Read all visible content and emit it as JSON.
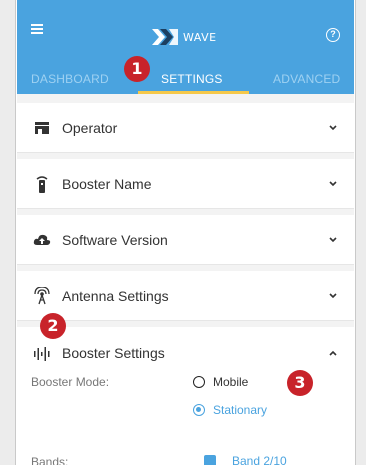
{
  "app": {
    "brand": "WAVE"
  },
  "tabs": [
    {
      "label": "DASHBOARD"
    },
    {
      "label": "SETTINGS",
      "active": true
    },
    {
      "label": "ADVANCED"
    }
  ],
  "callouts": [
    "1",
    "2",
    "3"
  ],
  "sections": [
    {
      "label": "Operator",
      "icon": "operator-icon"
    },
    {
      "label": "Booster Name",
      "icon": "booster-device-icon"
    },
    {
      "label": "Software Version",
      "icon": "cloud-upload-icon"
    },
    {
      "label": "Antenna Settings",
      "icon": "antenna-icon"
    },
    {
      "label": "Booster Settings",
      "icon": "signal-bars-icon",
      "expanded": true
    }
  ],
  "booster_settings": {
    "mode_label": "Booster Mode:",
    "mode_options": [
      {
        "label": "Mobile",
        "selected": false
      },
      {
        "label": "Stationary",
        "selected": true
      }
    ],
    "bands_label": "Bands:",
    "band_option": "Band 2/10"
  },
  "colors": {
    "header": "#4aa3df",
    "tab_indicator": "#f5c84a",
    "callout": "#c8232a",
    "accent": "#4aa3df"
  }
}
